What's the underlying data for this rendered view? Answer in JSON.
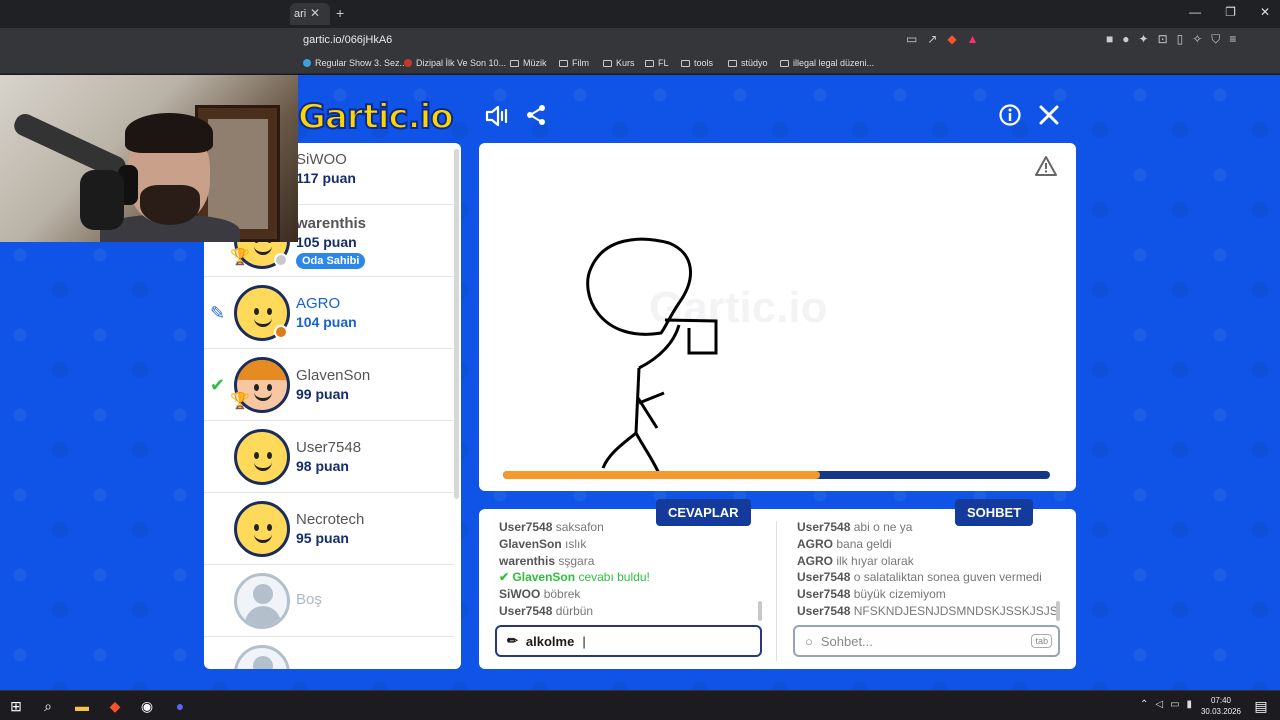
{
  "browser": {
    "tab_title": "ari",
    "url": "gartic.io/066jHkA6",
    "bookmarks": [
      "Regular Show 3. Sez...",
      "Dizipal İlk Ve Son 10...",
      "Müzik",
      "Film",
      "Kurs",
      "FL",
      "tools",
      "stüdyo",
      "illegal legal düzeni..."
    ]
  },
  "app": {
    "logo": "Gartic.io",
    "watermark": "Gartic.io"
  },
  "players": [
    {
      "name": "SiWOO",
      "score": "117 puan",
      "status_color": "#f2c200"
    },
    {
      "name": "warenthis",
      "score": "105 puan",
      "badge": "Oda Sahibi",
      "status_color": "#c8c8c8"
    },
    {
      "name": "AGRO",
      "score": "104 puan",
      "status_color": "#e07b1a"
    },
    {
      "name": "GlavenSon",
      "score": "99 puan"
    },
    {
      "name": "User7548",
      "score": "98 puan"
    },
    {
      "name": "Necrotech",
      "score": "95 puan"
    },
    {
      "name": "Boş",
      "score": ""
    }
  ],
  "round": {
    "progress_fraction": 0.58
  },
  "answers": {
    "title": "CEVAPLAR",
    "messages": [
      {
        "who": "User7548",
        "text": "saksafon"
      },
      {
        "who": "GlavenSon",
        "text": "ıslık"
      },
      {
        "who": "warenthis",
        "text": "sşgara"
      },
      {
        "who": "GlavenSon",
        "text": "cevabı buldu!",
        "correct": true
      },
      {
        "who": "SiWOO",
        "text": "böbrek"
      },
      {
        "who": "User7548",
        "text": "dürbün"
      }
    ],
    "input_value": "alkolme"
  },
  "chat": {
    "title": "SOHBET",
    "messages": [
      {
        "who": "User7548",
        "text": "abi o ne ya"
      },
      {
        "who": "AGRO",
        "text": "bana geldi"
      },
      {
        "who": "AGRO",
        "text": "ilk hıyar olarak"
      },
      {
        "who": "User7548",
        "text": "o salataliktan sonea guven vermedi"
      },
      {
        "who": "User7548",
        "text": "büyük cizemiyom"
      },
      {
        "who": "User7548",
        "text": "NFSKNDJESNJDSMNDSKJSSKJSJS"
      }
    ],
    "placeholder": "Sohbet...",
    "tab_hint": "tab"
  },
  "taskbar": {
    "time": "07:40",
    "date": "30.03.2026"
  }
}
